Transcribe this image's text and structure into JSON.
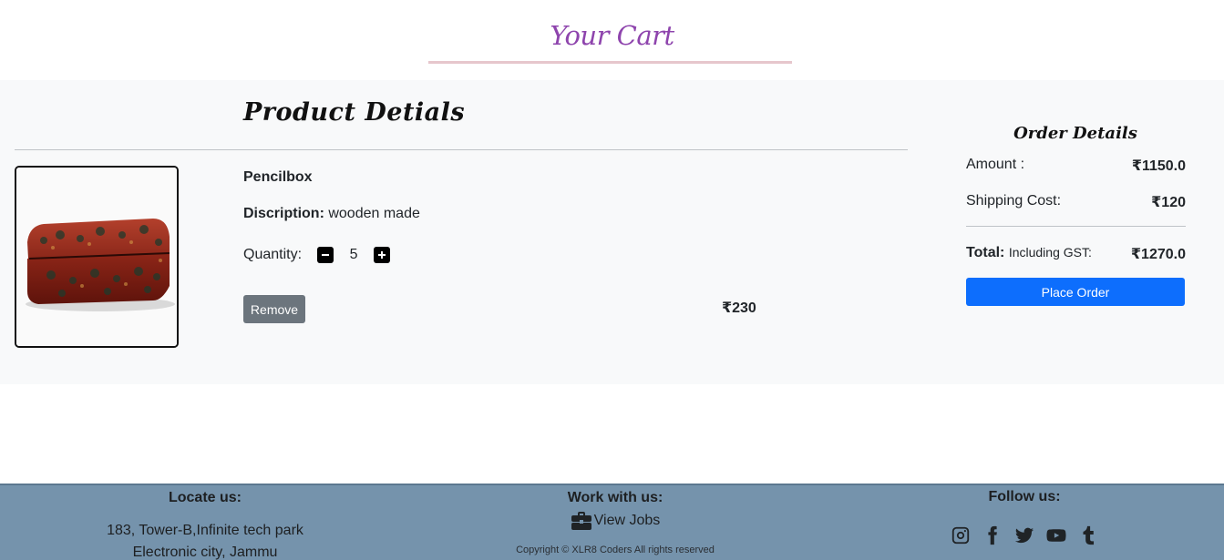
{
  "header": {
    "title": "Your Cart"
  },
  "product_section": {
    "heading": "Product Detials"
  },
  "item": {
    "name": "Pencilbox",
    "description_label": "Discription:",
    "description": "wooden made",
    "quantity_label": "Quantity:",
    "quantity": "5",
    "remove_label": "Remove",
    "price": "₹230"
  },
  "order": {
    "heading": "Order Details",
    "amount_label": "Amount :",
    "amount": "₹1150.0",
    "shipping_label": "Shipping Cost:",
    "shipping": "₹120",
    "total_label": "Total:",
    "total_note": "Including GST:",
    "total": "₹1270.0",
    "place_order_label": "Place Order"
  },
  "footer": {
    "locate_heading": "Locate us:",
    "address_line1": "183, Tower-B,Infinite tech park",
    "address_line2": "Electronic city, Jammu",
    "work_heading": "Work with us:",
    "jobs_label": "View Jobs",
    "copyright": "Copyright © XLR8 Coders All rights reserved",
    "follow_heading": "Follow us:",
    "social": [
      "instagram-icon",
      "facebook-icon",
      "twitter-icon",
      "youtube-icon",
      "tumblr-icon"
    ]
  },
  "colors": {
    "title": "#8e44ad",
    "primary_button": "#0d6efd",
    "secondary_button": "#6c757d",
    "footer_bg": "#7593ac",
    "panel_bg": "#f8f9fa"
  }
}
